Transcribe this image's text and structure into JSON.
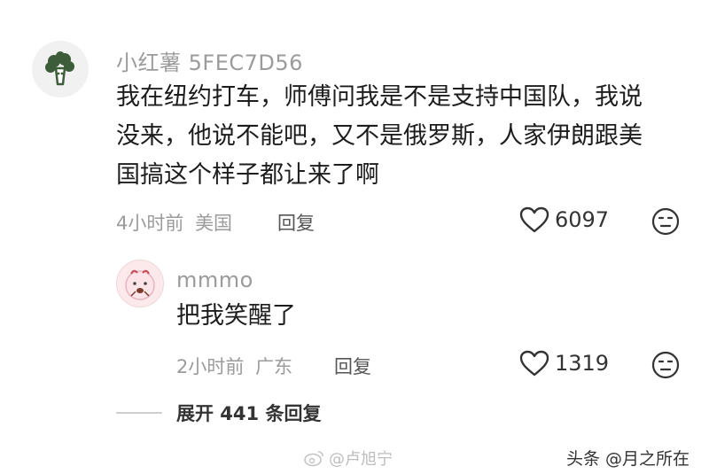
{
  "comment": {
    "username": "小红薯 5FEC7D56",
    "lines": [
      "我在纽约打车，师傅问我是不是支持中国队，我说",
      "没来，他说不能吧，又不是俄罗斯，人家伊朗跟美",
      "国搞这个样子都让来了啊"
    ],
    "time": "4小时前",
    "location": "美国",
    "reply_label": "回复",
    "likes": "6097"
  },
  "reply": {
    "username": "mmmo",
    "text": "把我笑醒了",
    "time": "2小时前",
    "location": "广东",
    "reply_label": "回复",
    "likes": "1319"
  },
  "expand_label": "展开 441 条回复",
  "watermarks": {
    "left": "@卢旭宁",
    "right": "头条 @月之所在"
  },
  "icons": {
    "main_avatar": "broccoli-icon",
    "reply_avatar": "cartoon-face-icon",
    "like": "heart-icon",
    "emoji": "neutral-face-icon",
    "weibo": "weibo-icon"
  }
}
